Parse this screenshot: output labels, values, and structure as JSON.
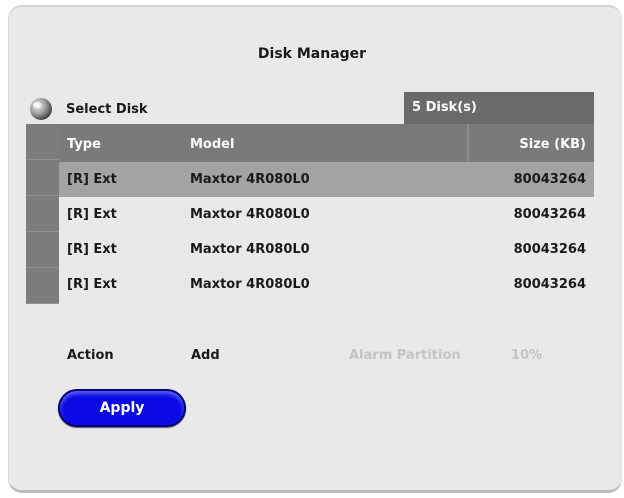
{
  "title": "Disk Manager",
  "select_disk": {
    "label": "Select Disk",
    "icon": "disk-icon",
    "count": "5 Disk(s)"
  },
  "table": {
    "headers": {
      "type": "Type",
      "model": "Model",
      "size": "Size (KB)"
    },
    "rows": [
      {
        "type": "[R] Ext",
        "model": "Maxtor 4R080L0",
        "size": "80043264"
      },
      {
        "type": "[R] Ext",
        "model": "Maxtor 4R080L0",
        "size": "80043264"
      },
      {
        "type": "[R] Ext",
        "model": "Maxtor 4R080L0",
        "size": "80043264"
      },
      {
        "type": "[R] Ext",
        "model": "Maxtor 4R080L0",
        "size": "80043264"
      }
    ],
    "selected_row": 0
  },
  "action": {
    "label": "Action",
    "value": "Add",
    "alarm_label": "Alarm Partition",
    "alarm_value": "10%"
  },
  "apply_button": {
    "label": "Apply"
  },
  "colors": {
    "panel": "#e9e9e9",
    "header": "#7a7a7a",
    "selected_row": "#a3a3a3",
    "apply_button": "#0a0ae6",
    "disabled_text": "#c4c4c4"
  }
}
